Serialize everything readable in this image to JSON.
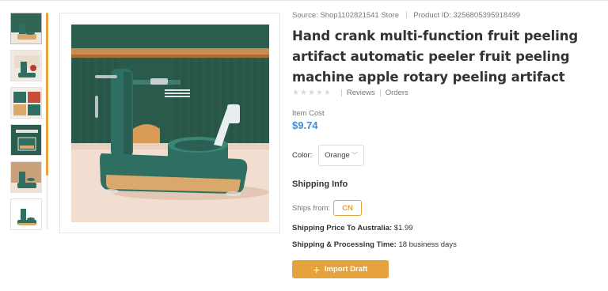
{
  "source_label": "Source:",
  "source_store": "Shop1102821541 Store",
  "product_id_label": "Product ID:",
  "product_id": "3256805395918499",
  "title": "Hand crank multi-function fruit peeling artifact automatic peeler fruit peeling machine apple rotary peeling artifact",
  "rating": {
    "stars": "★★★★★",
    "reviews_label": "Reviews",
    "orders_label": "Orders"
  },
  "item_cost_label": "Item Cost",
  "item_cost": "$9.74",
  "color_label": "Color:",
  "color_value": "Orange",
  "shipping_info_heading": "Shipping Info",
  "ships_from_label": "Ships from:",
  "ships_from_value": "CN",
  "shipping_price_label": "Shipping Price To Australia:",
  "shipping_price_value": "$1.99",
  "shipping_time_label": "Shipping & Processing Time:",
  "shipping_time_value": "18 business days",
  "import_button_label": "Import Draft",
  "colors": {
    "accent": "#e6a23c",
    "price": "#3f8bd6",
    "machine_green": "#2f6f62",
    "machine_tan": "#d9a86a"
  }
}
